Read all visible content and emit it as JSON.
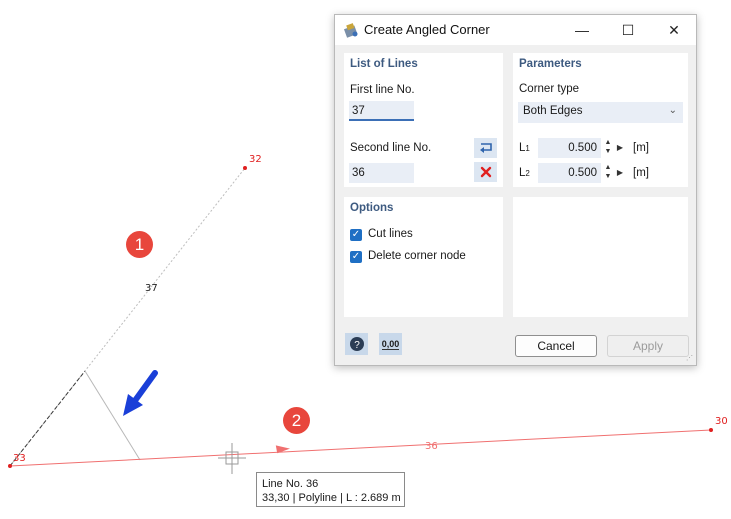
{
  "canvas": {
    "nodes": [
      {
        "id": "32",
        "label": "32"
      },
      {
        "id": "33",
        "label": "33"
      },
      {
        "id": "30",
        "label": "30"
      }
    ],
    "line_labels": {
      "line37": "37",
      "line36": "36"
    },
    "markers": [
      "1",
      "2"
    ],
    "tooltip": {
      "line1": "Line No. 36",
      "line2": "33,30 | Polyline  | L : 2.689 m"
    },
    "colors": {
      "line36": "#f07070",
      "line37": "#505050",
      "marker": "#e8463c",
      "arrow": "#1a3fd8"
    }
  },
  "dialog": {
    "title": "Create Angled Corner",
    "controls": {
      "minimize": "—",
      "maximize": "☐",
      "close": "✕"
    },
    "list_of_lines": {
      "title": "List of Lines",
      "first_line_label": "First line No.",
      "first_line_value": "37",
      "second_line_label": "Second line No.",
      "second_line_value": "36"
    },
    "parameters": {
      "title": "Parameters",
      "corner_type_label": "Corner type",
      "corner_type_value": "Both Edges",
      "l1_label": "L",
      "l1_sub": "1",
      "l1_value": "0.500",
      "l1_unit": "[m]",
      "l2_label": "L",
      "l2_sub": "2",
      "l2_value": "0.500",
      "l2_unit": "[m]"
    },
    "options": {
      "title": "Options",
      "cut_lines": "Cut lines",
      "cut_lines_checked": true,
      "delete_corner_node": "Delete corner node",
      "delete_corner_node_checked": true
    },
    "footer": {
      "units_icon_label": "0,00",
      "cancel": "Cancel",
      "apply": "Apply"
    }
  }
}
